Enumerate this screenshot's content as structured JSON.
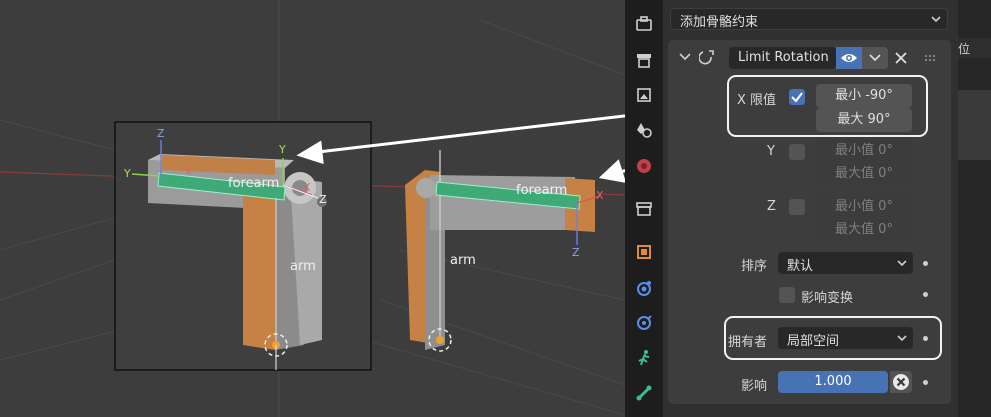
{
  "viewport": {
    "left_rig": {
      "forearm": "forearm",
      "arm": "arm",
      "axes": {
        "z_top": "Z",
        "y_left": "Y",
        "x_small": "X",
        "y_top": "Y",
        "x_right": "X",
        "z_right": "Z"
      }
    },
    "right_rig": {
      "forearm": "forearm",
      "arm": "arm",
      "axes": {
        "x_right": "X",
        "z_bottom": "Z"
      }
    }
  },
  "panel": {
    "add_constraint": "添加骨骼约束",
    "constraint": {
      "name": "Limit Rotation",
      "x": {
        "label": "X 限值",
        "checked": true,
        "min": "最小  -90°",
        "max": "最大   90°"
      },
      "y": {
        "label": "Y",
        "checked": false,
        "min": "最小值  0°",
        "max": "最大值  0°"
      },
      "z": {
        "label": "Z",
        "checked": false,
        "min": "最小值  0°",
        "max": "最大值  0°"
      },
      "order": {
        "label": "排序",
        "value": "默认"
      },
      "affect_transform": {
        "label": "影响变换",
        "checked": false
      },
      "owner": {
        "label": "拥有者",
        "value": "局部空间"
      },
      "influence": {
        "label": "影响",
        "value": "1.000",
        "fraction": 1.0
      }
    },
    "right_edge_text": "位"
  },
  "colors": {
    "accent": "#4772b3",
    "panel_bg": "#303030",
    "field": "#545454",
    "bone_green": "#3fa978",
    "arm_orange": "#c88443"
  },
  "icons": [
    "tool-icon",
    "render-icon",
    "output-icon",
    "view-layer-icon",
    "scene-icon",
    "world-icon",
    "collection-icon",
    "object-icon",
    "modifier-icon",
    "particles-icon",
    "physics-icon",
    "constraint-icon",
    "bone-icon",
    "eye-icon",
    "chevron-down-icon",
    "close-icon",
    "drag-handle-icon"
  ]
}
